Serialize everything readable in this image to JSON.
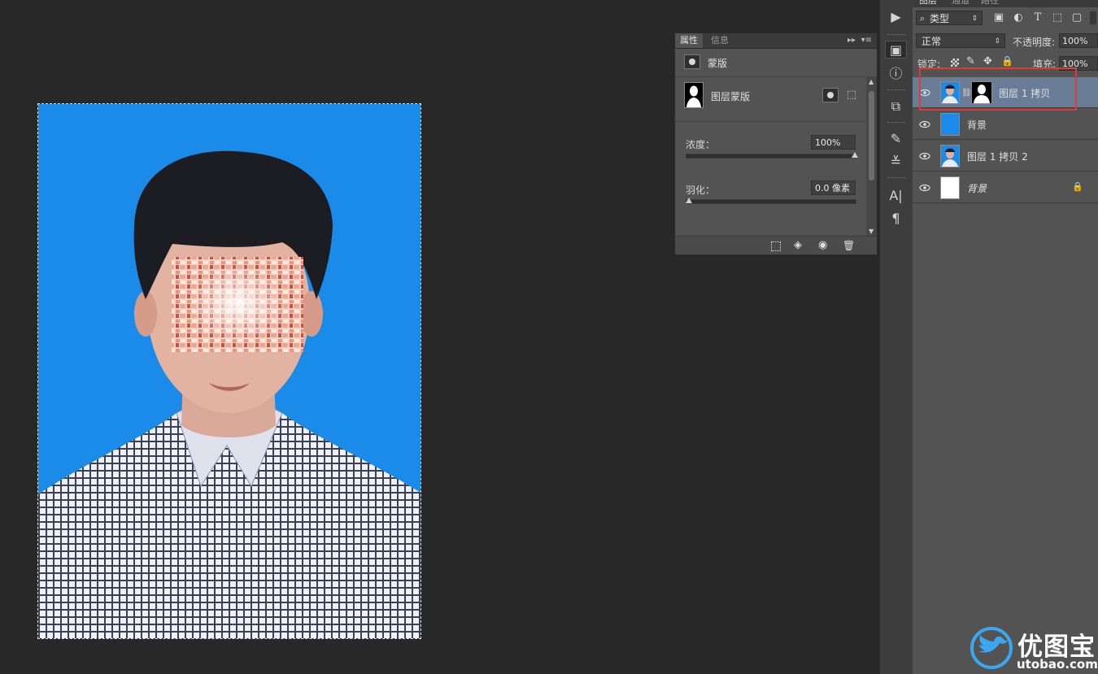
{
  "properties_panel": {
    "tabs": [
      "属性",
      "信息"
    ],
    "header_label": "蒙版",
    "mask_label": "图层蒙版",
    "density_label": "浓度：",
    "density_value": "100%",
    "density_fraction": 1.0,
    "feather_label": "羽化：",
    "feather_value": "0.0 像素",
    "feather_fraction": 0.0
  },
  "layers_panel": {
    "tabs": [
      "图层",
      "通道",
      "路径"
    ],
    "filter_kind": "类型",
    "blend_mode": "正常",
    "opacity_label": "不透明度:",
    "opacity_value": "100%",
    "lock_label": "锁定:",
    "fill_label": "填充:",
    "fill_value": "100%",
    "layers": [
      {
        "name": "图层 1 拷贝",
        "thumb": "portrait",
        "has_mask": true,
        "selected": true,
        "locked": false,
        "italic": false
      },
      {
        "name": "背景",
        "thumb": "blue",
        "has_mask": false,
        "selected": false,
        "locked": false,
        "italic": false
      },
      {
        "name": "图层 1 拷贝 2",
        "thumb": "portrait",
        "has_mask": false,
        "selected": false,
        "locked": false,
        "italic": false
      },
      {
        "name": "背景",
        "thumb": "white",
        "has_mask": false,
        "selected": false,
        "locked": true,
        "italic": true
      }
    ]
  },
  "colors": {
    "background": "#282828",
    "photo_background": "#1a8be8",
    "selected_layer": "#6a7d97",
    "highlight_box": "#e03a3a",
    "panel": "#535353"
  },
  "watermark": {
    "brand": "优图宝",
    "url": "utobao.com"
  }
}
